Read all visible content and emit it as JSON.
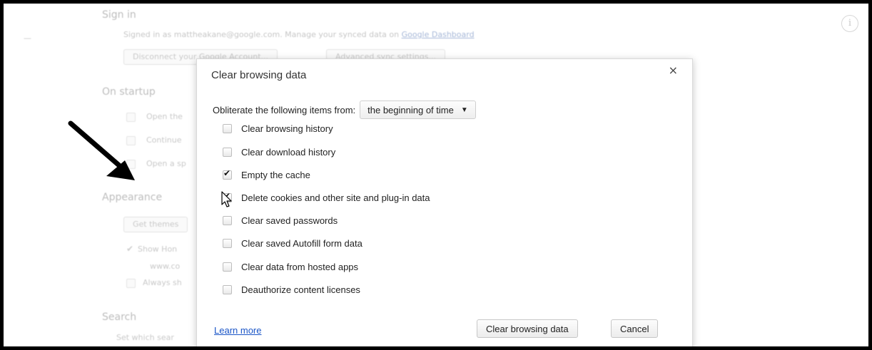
{
  "background": {
    "sign_in": {
      "heading": "Sign in",
      "text": "Signed in as mattheakane@google.com. Manage your synced data on",
      "link": "Google Dashboard",
      "disconnect_btn": "Disconnect your Google Account...",
      "advanced_btn": "Advanced sync settings..."
    },
    "on_startup": {
      "heading": "On startup",
      "items": [
        "Open the",
        "Continue",
        "Open a sp"
      ]
    },
    "appearance": {
      "heading": "Appearance",
      "get_themes_btn": "Get themes",
      "show_home": "Show Hon",
      "url": "www.co",
      "always": "Always sh"
    },
    "search": {
      "heading": "Search",
      "text": "Set which sear"
    }
  },
  "dialog": {
    "title": "Clear browsing data",
    "close_glyph": "×",
    "obliterate_label": "Obliterate the following items from:",
    "time_range": "the beginning of time",
    "options": [
      {
        "label": "Clear browsing history",
        "checked": false
      },
      {
        "label": "Clear download history",
        "checked": false
      },
      {
        "label": "Empty the cache",
        "checked": true
      },
      {
        "label": "Delete cookies and other site and plug-in data",
        "checked": true
      },
      {
        "label": "Clear saved passwords",
        "checked": false
      },
      {
        "label": "Clear saved Autofill form data",
        "checked": false
      },
      {
        "label": "Clear data from hosted apps",
        "checked": false
      },
      {
        "label": "Deauthorize content licenses",
        "checked": false
      }
    ],
    "learn_more": "Learn more",
    "clear_button": "Clear browsing data",
    "cancel_button": "Cancel"
  },
  "colors": {
    "link": "#1a55c7",
    "annotation_arrow": "#000000"
  }
}
